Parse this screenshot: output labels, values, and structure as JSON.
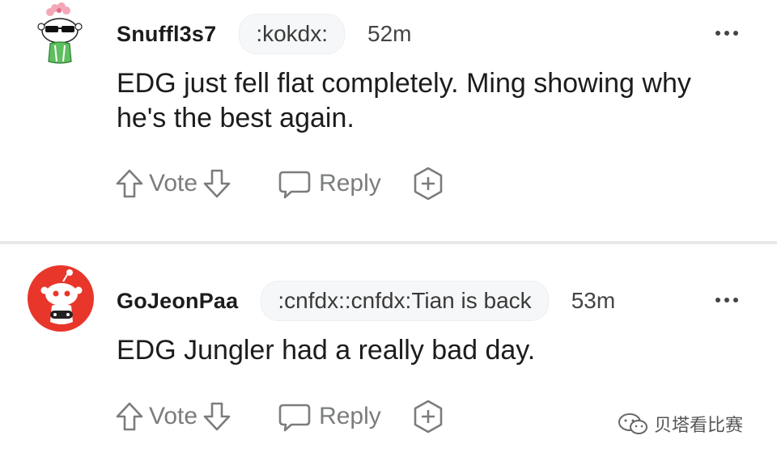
{
  "comments": [
    {
      "username": "Snuffl3s7",
      "flair": ":kokdx:",
      "time": "52m",
      "body": "EDG just fell flat completely. Ming showing why he's the best again.",
      "vote_label": "Vote",
      "reply_label": "Reply",
      "avatar_icon": "snoo-sunglasses-avatar-icon"
    },
    {
      "username": "GoJeonPaa",
      "flair": ":cnfdx::cnfdx:Tian is back",
      "time": "53m",
      "body": "EDG Jungler had a really bad day.",
      "vote_label": "Vote",
      "reply_label": "Reply",
      "avatar_icon": "snoo-red-avatar-icon"
    }
  ],
  "watermark": {
    "label": "贝塔看比赛",
    "icon": "wechat-icon"
  },
  "colors": {
    "text": "#1c1c1c",
    "meta": "#7a7c7e",
    "flair_bg": "#f6f7f8",
    "avatar_red": "#e8362b"
  }
}
